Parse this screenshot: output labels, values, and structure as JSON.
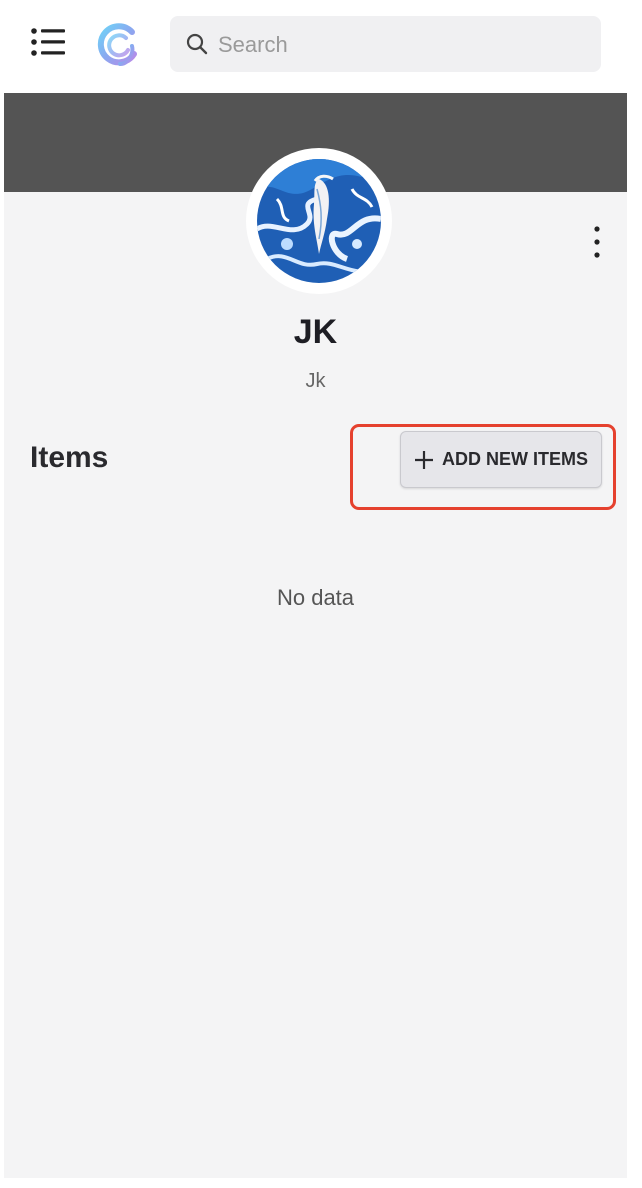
{
  "header": {
    "menu_icon": "hamburger-menu-icon",
    "logo_icon": "app-logo-icon",
    "search": {
      "placeholder": "Search",
      "value": "",
      "icon": "search-icon"
    }
  },
  "profile": {
    "name": "JK",
    "handle": "Jk",
    "avatar": "blue-marble-avatar",
    "more_icon": "more-vertical-icon",
    "banner_color": "#545454"
  },
  "items": {
    "title": "Items",
    "add_button": {
      "icon": "plus-icon",
      "label": "ADD NEW ITEMS"
    },
    "empty_text": "No data"
  },
  "annotation": {
    "highlight_color": "#e5412e"
  }
}
